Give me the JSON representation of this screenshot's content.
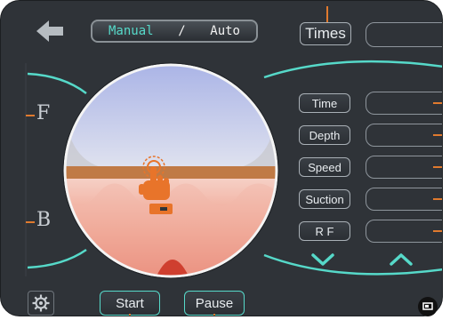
{
  "header": {
    "mode_manual": "Manual",
    "mode_separator": "/",
    "mode_auto": "Auto",
    "times_label": "Times"
  },
  "params": {
    "time": "Time",
    "depth": "Depth",
    "speed": "Speed",
    "suction": "Suction",
    "rf": "R F"
  },
  "side": {
    "front": "F",
    "back": "B"
  },
  "footer": {
    "start": "Start",
    "pause": "Pause"
  },
  "colors": {
    "panel": "#2f3338",
    "accent_teal": "#56d9c9",
    "tick_orange": "#e07a2e",
    "hand_orange": "#e8742a"
  },
  "icons": {
    "back": "back-arrow-icon",
    "hand": "hand-touch-icon",
    "settings": "gear-icon",
    "down": "chevron-down-icon",
    "up": "chevron-up-icon"
  }
}
